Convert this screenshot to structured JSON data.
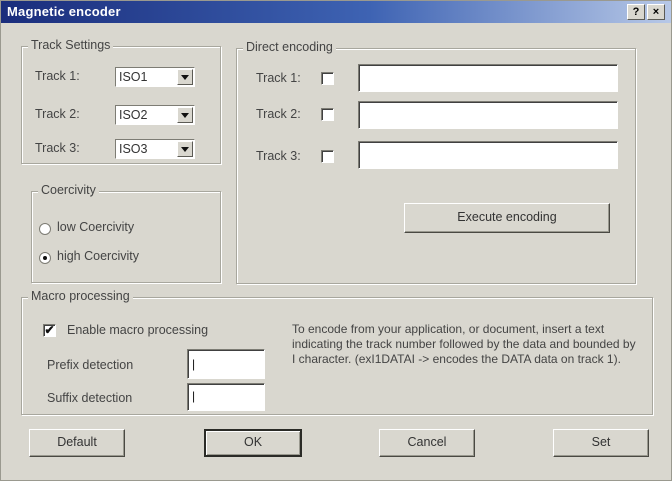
{
  "window": {
    "title": "Magnetic encoder",
    "help_glyph": "?",
    "close_glyph": "×"
  },
  "track_settings": {
    "title": "Track Settings",
    "tracks": [
      {
        "label": "Track 1:",
        "value": "ISO1"
      },
      {
        "label": "Track 2:",
        "value": "ISO2"
      },
      {
        "label": "Track 3:",
        "value": "ISO3"
      }
    ]
  },
  "direct_encoding": {
    "title": "Direct encoding",
    "tracks": [
      {
        "label": "Track 1:",
        "checked": false,
        "value": ""
      },
      {
        "label": "Track 2:",
        "checked": false,
        "value": ""
      },
      {
        "label": "Track 3:",
        "checked": false,
        "value": ""
      }
    ],
    "execute_label": "Execute encoding"
  },
  "coercivity": {
    "title": "Coercivity",
    "options": [
      {
        "label": "low Coercivity",
        "selected": false
      },
      {
        "label": "high Coercivity",
        "selected": true
      }
    ]
  },
  "macro_processing": {
    "title": "Macro processing",
    "enable_label": "Enable macro processing",
    "enable_checked": true,
    "check_glyph": "✔",
    "prefix_label": "Prefix detection",
    "prefix_value": "|",
    "suffix_label": "Suffix detection",
    "suffix_value": "|",
    "description": "To encode from your application, or document, insert a text indicating the track number followed by the data and bounded by I character. (exI1DATAI -> encodes the DATA data on track 1)."
  },
  "buttons": {
    "default": "Default",
    "ok": "OK",
    "cancel": "Cancel",
    "set": "Set"
  }
}
